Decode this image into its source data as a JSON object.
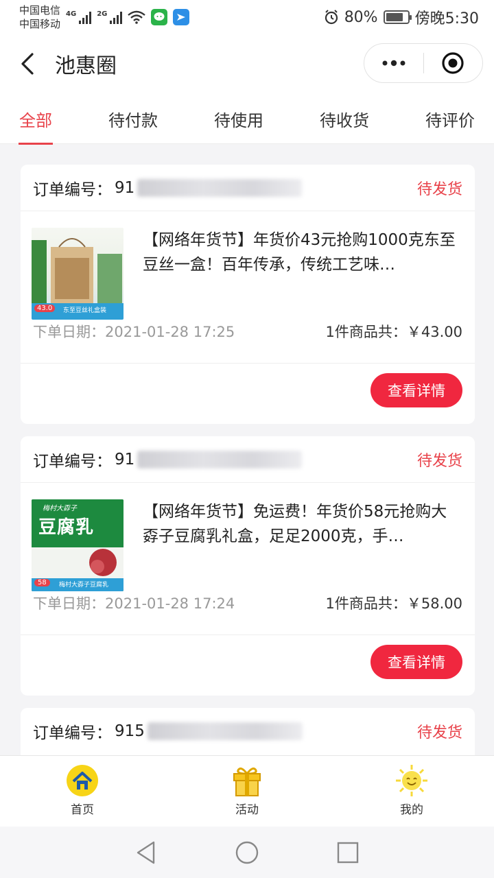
{
  "status_bar": {
    "carrier1": "中国电信",
    "carrier2": "中国移动",
    "net1": "4G",
    "net2": "2G",
    "alarm_icon": "alarm-icon",
    "battery": "80%",
    "battery_level": 0.8,
    "time": "傍晚5:30"
  },
  "header": {
    "title": "池惠圈",
    "back_icon": "chevron-left-icon",
    "more_icon": "more-dots-icon",
    "close_icon": "target-close-icon"
  },
  "tabs": [
    {
      "label": "全部",
      "active": true
    },
    {
      "label": "待付款",
      "active": false
    },
    {
      "label": "待使用",
      "active": false
    },
    {
      "label": "待收货",
      "active": false
    },
    {
      "label": "待评价",
      "active": false
    }
  ],
  "orders": [
    {
      "order_label": "订单编号：",
      "order_no_visible": "91",
      "status": "待发货",
      "title": "【网络年货节】年货价43元抢购1000克东至豆丝一盒！百年传承，传统工艺味…",
      "thumb_price": "43.0",
      "thumb_caption": "东至豆丝礼盒装",
      "date_label": "下单日期：",
      "date": "2021-01-28 17:25",
      "summary": "1件商品共：￥43.00",
      "button": "查看详情"
    },
    {
      "order_label": "订单编号：",
      "order_no_visible": "91",
      "status": "待发货",
      "title": "【网络年货节】免运费！年货价58元抢购大孬子豆腐乳礼盒，足足2000克，手…",
      "thumb_price": "58",
      "thumb_caption": "梅村大孬子豆腐乳",
      "thumb_heading": "豆腐乳",
      "thumb_subheading": "梅村大孬子",
      "date_label": "下单日期：",
      "date": "2021-01-28 17:24",
      "summary": "1件商品共：￥58.00",
      "button": "查看详情"
    },
    {
      "order_label": "订单编号：",
      "order_no_visible": "915",
      "status": "待发货"
    }
  ],
  "tabbar": [
    {
      "label": "首页",
      "icon": "home-icon"
    },
    {
      "label": "活动",
      "icon": "gift-icon"
    },
    {
      "label": "我的",
      "icon": "sun-face-icon"
    }
  ],
  "colors": {
    "accent": "#e8424a",
    "button": "#f0273f"
  }
}
